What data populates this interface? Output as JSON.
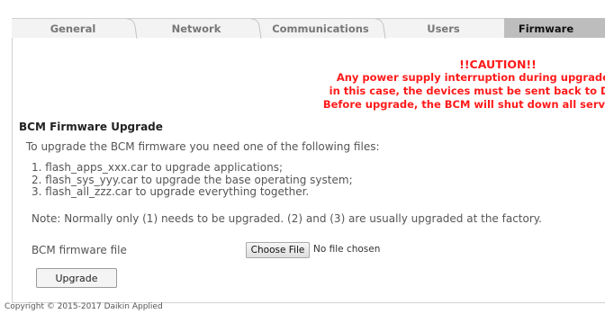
{
  "tabs": [
    {
      "label": "General",
      "active": false
    },
    {
      "label": "Network",
      "active": false
    },
    {
      "label": "Communications",
      "active": false
    },
    {
      "label": "Users",
      "active": false
    },
    {
      "label": "Firmware",
      "active": true
    }
  ],
  "caution": {
    "heading": "!!CAUTION!!",
    "line1": "Any power supply interruption during upgrade may cor",
    "line2": "in this case, the devices must be sent back to Daikin for r",
    "line3": "Before upgrade, the BCM will shut down all services in orde",
    "color": "#ff1a1a"
  },
  "firmware": {
    "title": "BCM Firmware Upgrade",
    "intro": "To upgrade the BCM firmware you need one of the following files:",
    "files": [
      "1. flash_apps_xxx.car to upgrade applications;",
      "2. flash_sys_yyy.car to upgrade the base operating system;",
      "3. flash_all_zzz.car to upgrade everything together."
    ],
    "note": "Note: Normally only (1) needs to be upgraded. (2) and (3) are usually upgraded at the factory.",
    "file_label": "BCM firmware file",
    "choose_file_label": "Choose File",
    "no_file_text": "No file chosen",
    "upgrade_label": "Upgrade"
  },
  "footer": {
    "copyright": "Copyright © 2015-2017 Daikin Applied"
  }
}
